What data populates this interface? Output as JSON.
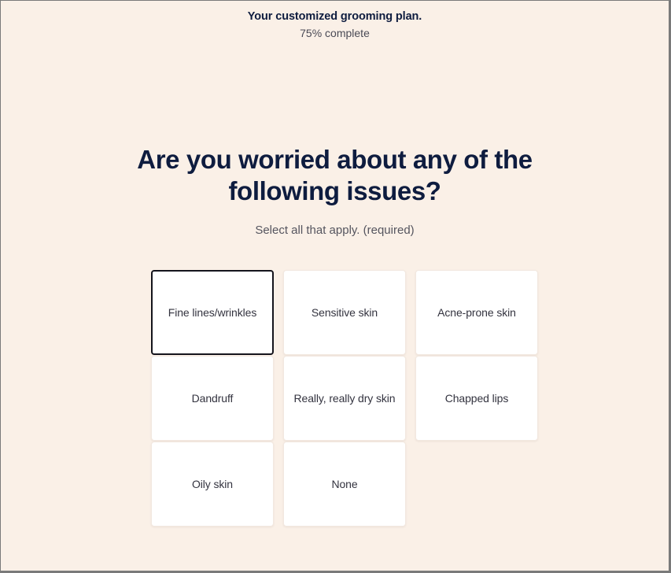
{
  "progress": {
    "title": "Your customized grooming plan.",
    "subtitle": "75% complete",
    "percent_complete": 75
  },
  "question": {
    "heading": "Are you worried about any of the following issues?",
    "hint": "Select all that apply. (required)"
  },
  "options": [
    {
      "label": "Fine lines/wrinkles",
      "selected": true
    },
    {
      "label": "Sensitive skin",
      "selected": false
    },
    {
      "label": "Acne-prone skin",
      "selected": false
    },
    {
      "label": "Dandruff",
      "selected": false
    },
    {
      "label": "Really, really dry skin",
      "selected": false
    },
    {
      "label": "Chapped lips",
      "selected": false
    },
    {
      "label": "Oily skin",
      "selected": false
    },
    {
      "label": "None",
      "selected": false
    }
  ],
  "colors": {
    "background": "#faf0e7",
    "heading": "#0e1c3f",
    "card_background": "#ffffff",
    "card_border": "#f2e8e0",
    "card_selected_border": "#14141c",
    "label_text": "#33333f",
    "hint_text": "#55555f"
  }
}
